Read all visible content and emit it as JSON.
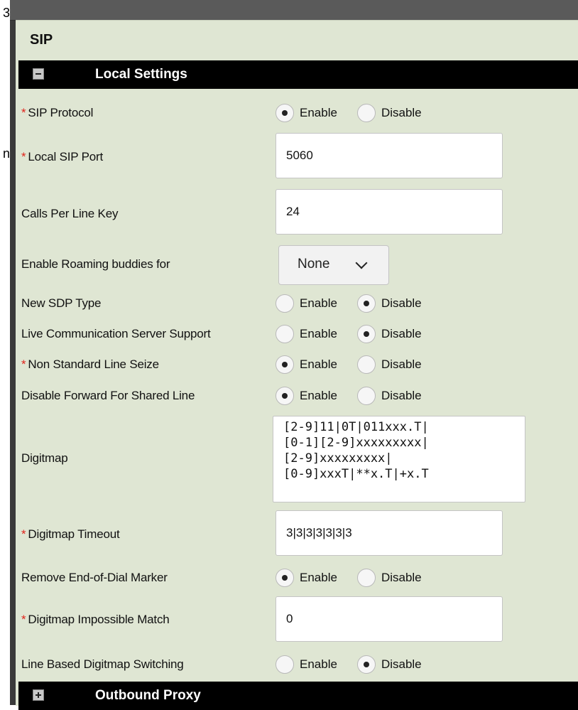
{
  "left_fragments": [
    "3",
    "n"
  ],
  "panel": {
    "title": "SIP"
  },
  "sections": {
    "local": "Local Settings",
    "outbound": "Outbound Proxy"
  },
  "option_labels": {
    "enable": "Enable",
    "disable": "Disable"
  },
  "required_marker": "*",
  "fields": {
    "sip_protocol": {
      "label": "SIP Protocol",
      "required": true,
      "selected": "Enable"
    },
    "local_sip_port": {
      "label": "Local SIP Port",
      "required": true,
      "value": "5060"
    },
    "calls_per_line_key": {
      "label": "Calls Per Line Key",
      "required": false,
      "value": "24"
    },
    "roaming_buddies": {
      "label": "Enable Roaming buddies for",
      "required": false,
      "value": "None"
    },
    "new_sdp_type": {
      "label": "New SDP Type",
      "required": false,
      "selected": "Disable"
    },
    "lcs_support": {
      "label": "Live Communication Server Support",
      "required": false,
      "selected": "Disable"
    },
    "non_standard_line_seize": {
      "label": "Non Standard Line Seize",
      "required": true,
      "selected": "Enable"
    },
    "disable_forward_shared": {
      "label": "Disable Forward For Shared Line",
      "required": false,
      "selected": "Enable"
    },
    "digitmap": {
      "label": "Digitmap",
      "required": false,
      "value": "[2-9]11|0T|011xxx.T|\n[0-1][2-9]xxxxxxxxx|\n[2-9]xxxxxxxxx|\n[0-9]xxxT|**x.T|+x.T"
    },
    "digitmap_timeout": {
      "label": "Digitmap Timeout",
      "required": true,
      "value": "3|3|3|3|3|3|3"
    },
    "remove_end_of_dial": {
      "label": "Remove End-of-Dial Marker",
      "required": false,
      "selected": "Enable"
    },
    "digitmap_impossible": {
      "label": "Digitmap Impossible Match",
      "required": true,
      "value": "0"
    },
    "line_based_digitmap": {
      "label": "Line Based Digitmap Switching",
      "required": false,
      "selected": "Disable"
    }
  },
  "icons": {
    "collapse": "collapse-minus-icon",
    "expand": "expand-plus-icon",
    "dropdown": "chevron-down-icon"
  }
}
